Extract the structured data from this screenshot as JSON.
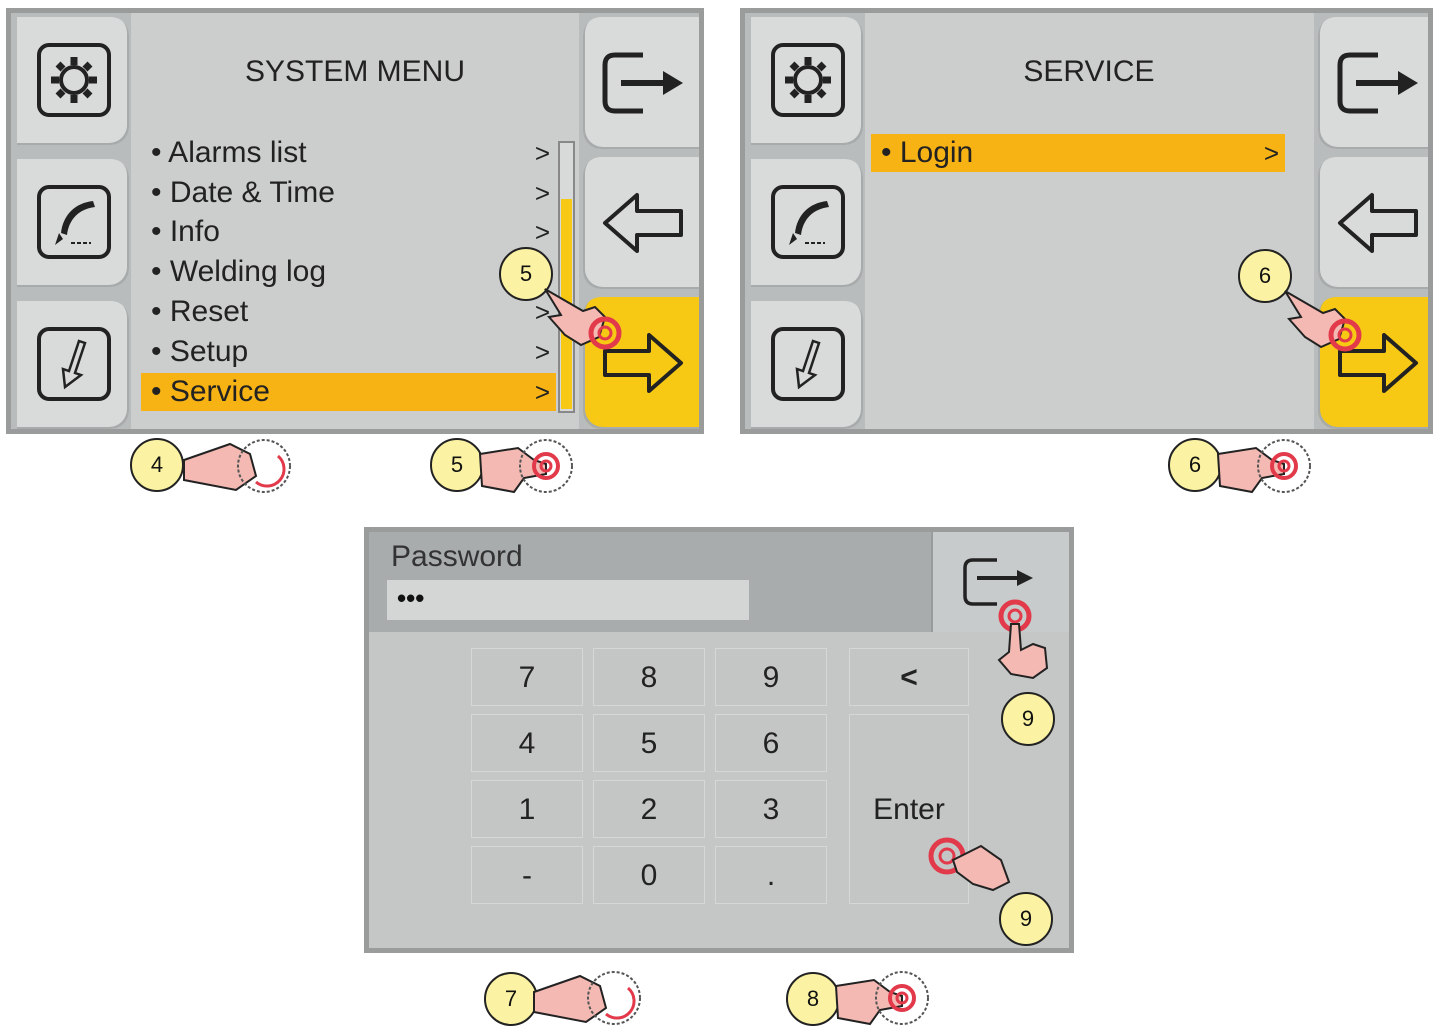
{
  "screen1": {
    "title": "SYSTEM MENU",
    "items": [
      {
        "label": "• Alarms list",
        "arrow": ">"
      },
      {
        "label": "• Date & Time",
        "arrow": ">"
      },
      {
        "label": "• Info",
        "arrow": ">"
      },
      {
        "label": "• Welding log",
        "arrow": ">"
      },
      {
        "label": "• Reset",
        "arrow": ">"
      },
      {
        "label": "• Setup",
        "arrow": ">"
      },
      {
        "label": "• Service",
        "arrow": ">"
      }
    ],
    "selected": "Service",
    "scroll_position": 0.25
  },
  "screen2": {
    "title": "SERVICE",
    "items": [
      {
        "label": "• Login",
        "arrow": ">"
      }
    ]
  },
  "screen3": {
    "title": "Password",
    "field_value": "•••",
    "keys": [
      "7",
      "8",
      "9",
      "<",
      "4",
      "5",
      "6",
      "1",
      "2",
      "3",
      "Enter",
      "-",
      "0",
      "."
    ]
  },
  "callouts": {
    "c4": "4",
    "c5a": "5",
    "c5b": "5",
    "c6a": "6",
    "c6b": "6",
    "c7": "7",
    "c8": "8",
    "c9a": "9",
    "c9b": "9"
  },
  "icons": [
    "settings-icon",
    "torch-icon",
    "arrow-down-icon",
    "exit-icon",
    "back-arrow-icon",
    "forward-arrow-icon",
    "touch-hand-icon",
    "rotate-knob-icon"
  ],
  "colors": {
    "highlight": "#f7b214",
    "yellow_button": "#f7c915",
    "callout": "#fbf3a3",
    "screen_bg": "#cbcecc"
  }
}
